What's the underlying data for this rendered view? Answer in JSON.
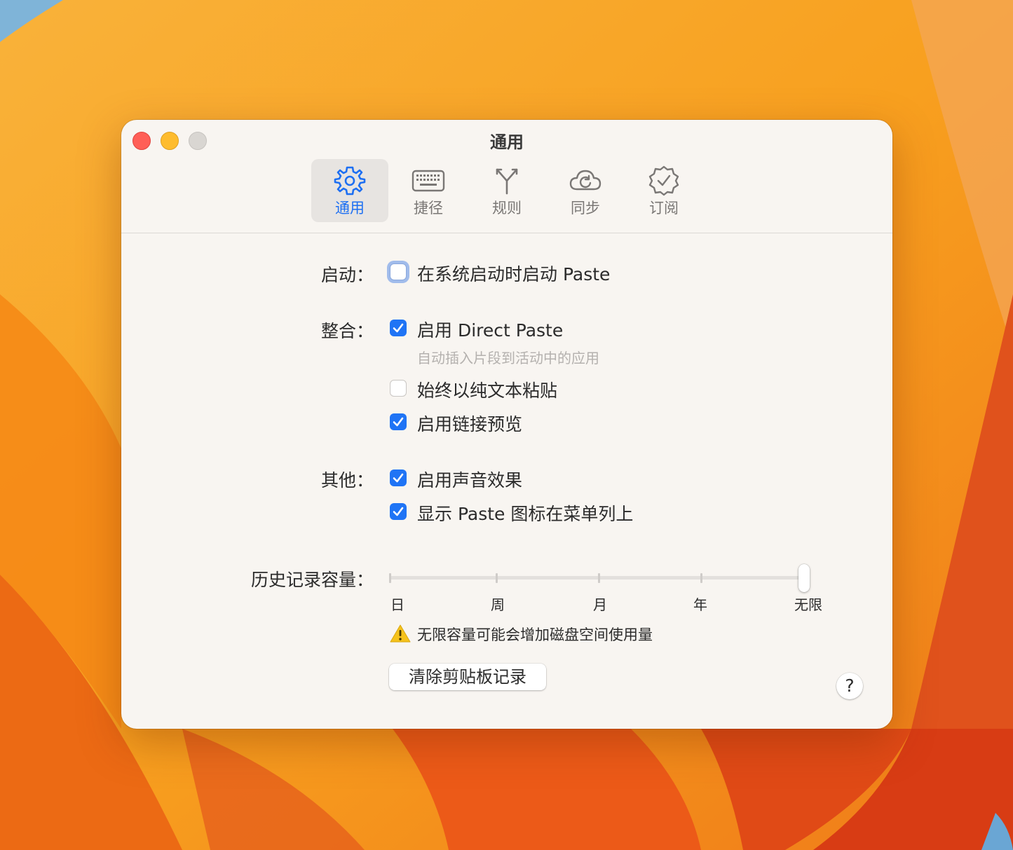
{
  "window": {
    "title": "通用"
  },
  "tabs": [
    {
      "label": "通用",
      "icon": "gear-icon",
      "active": true
    },
    {
      "label": "捷径",
      "icon": "keyboard-icon",
      "active": false
    },
    {
      "label": "规则",
      "icon": "fork-icon",
      "active": false
    },
    {
      "label": "同步",
      "icon": "cloud-sync-icon",
      "active": false
    },
    {
      "label": "订阅",
      "icon": "verified-badge-icon",
      "active": false
    }
  ],
  "startup": {
    "label": "启动：",
    "launch_at_login": {
      "label": "在系统启动时启动 Paste",
      "checked": false
    }
  },
  "integration": {
    "label": "整合：",
    "direct_paste": {
      "label": "启用 Direct Paste",
      "checked": true,
      "description": "自动插入片段到活动中的应用"
    },
    "plain_text": {
      "label": "始终以纯文本粘贴",
      "checked": false
    },
    "link_preview": {
      "label": "启用链接预览",
      "checked": true
    }
  },
  "other": {
    "label": "其他：",
    "sound_effects": {
      "label": "启用声音效果",
      "checked": true
    },
    "menu_bar_icon": {
      "label": "显示 Paste 图标在菜单列上",
      "checked": true
    }
  },
  "history": {
    "label": "历史记录容量：",
    "ticks": [
      "日",
      "周",
      "月",
      "年",
      "无限"
    ],
    "selected": "无限",
    "selected_index": 4,
    "warning": "无限容量可能会增加磁盘空间使用量",
    "clear_button": "清除剪贴板记录"
  },
  "help_button": "?",
  "colors": {
    "accent": "#1f74f5",
    "window_bg": "#f8f5f1",
    "close": "#ff5f57",
    "minimize": "#febc2e",
    "zoom_disabled": "#d9d6d2"
  }
}
